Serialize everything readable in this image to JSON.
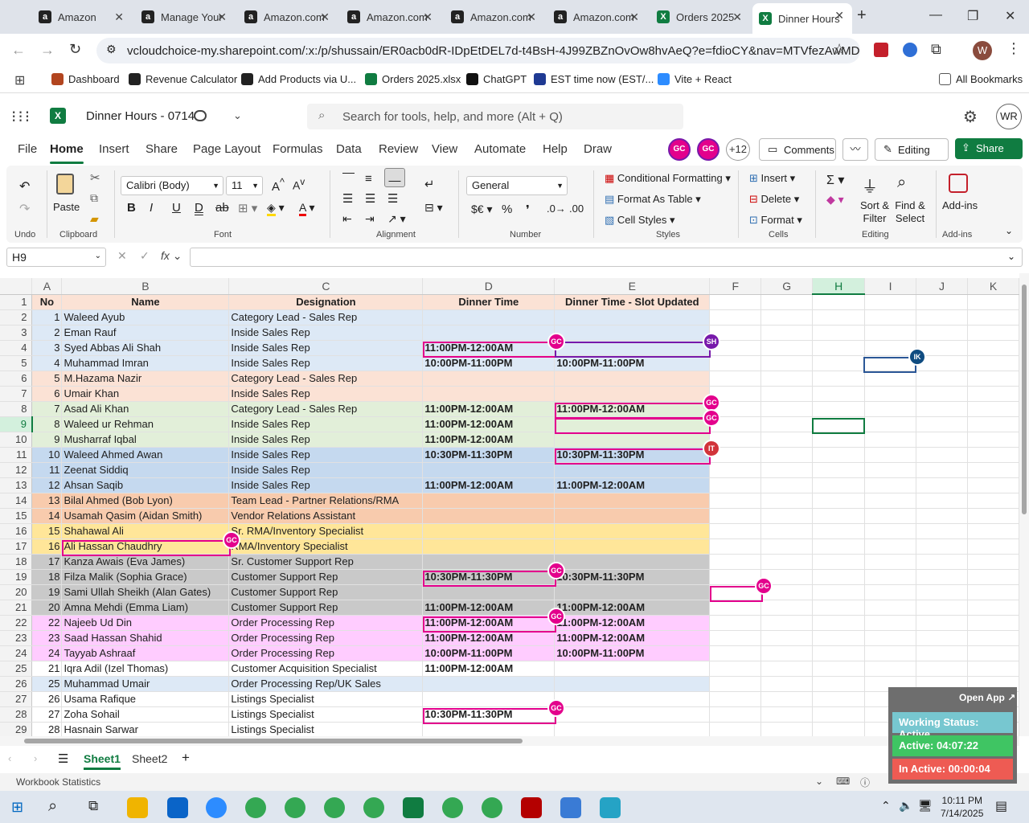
{
  "browser": {
    "tabs": [
      {
        "label": "Amazon",
        "icon": "amazon-icon"
      },
      {
        "label": "Manage Your",
        "icon": "amazon-icon"
      },
      {
        "label": "Amazon.com",
        "icon": "amazon-icon"
      },
      {
        "label": "Amazon.com",
        "icon": "amazon-icon"
      },
      {
        "label": "Amazon.com",
        "icon": "amazon-icon"
      },
      {
        "label": "Amazon.com",
        "icon": "amazon-icon"
      },
      {
        "label": "Orders 2025",
        "icon": "excel-icon"
      },
      {
        "label": "Dinner Hours",
        "icon": "excel-icon"
      }
    ],
    "url": "vcloudchoice-my.sharepoint.com/:x:/p/shussain/ER0acb0dR-IDpEtDEL7d-t4BsH-4J99ZBZnOvOw8hvAeQ?e=fdioCY&nav=MTVfezAwMDA...",
    "profile_initial": "W",
    "bookmarks": [
      "Dashboard",
      "Revenue Calculator",
      "Add Products via U...",
      "Orders 2025.xlsx",
      "ChatGPT",
      "EST time now (EST/...",
      "Vite + React"
    ],
    "all_bookmarks": "All Bookmarks"
  },
  "excel": {
    "doc_title": "Dinner Hours - 0714",
    "search_placeholder": "Search for tools, help, and more (Alt + Q)",
    "user_initials": "WR",
    "menus": [
      "File",
      "Home",
      "Insert",
      "Share",
      "Page Layout",
      "Formulas",
      "Data",
      "Review",
      "View",
      "Automate",
      "Help",
      "Draw"
    ],
    "collab_count": "+12",
    "comments_label": "Comments",
    "editing_label": "Editing",
    "share_label": "Share",
    "ribbon": {
      "undo_group": "Undo",
      "paste": "Paste",
      "clipboard": "Clipboard",
      "font_name": "Calibri (Body)",
      "font_size": "11",
      "font_group": "Font",
      "alignment_group": "Alignment",
      "number_format": "General",
      "number_group": "Number",
      "conditional_formatting": "Conditional Formatting",
      "format_as_table": "Format As Table",
      "cell_styles": "Cell Styles",
      "styles_group": "Styles",
      "insert": "Insert",
      "delete": "Delete",
      "format": "Format",
      "cells_group": "Cells",
      "sort_filter": "Sort & Filter",
      "find_select": "Find & Select",
      "editing_group": "Editing",
      "addins": "Add-ins",
      "addins_group": "Add-ins"
    },
    "name_box": "H9",
    "columns": [
      "A",
      "B",
      "C",
      "D",
      "E",
      "F",
      "G",
      "H",
      "I",
      "J",
      "K"
    ],
    "header_row": {
      "no": "No",
      "name": "Name",
      "designation": "Designation",
      "dinner": "Dinner Time",
      "slot": "Dinner Time - Slot Updated"
    },
    "rows": [
      {
        "r": "2",
        "no": "1",
        "name": "Waleed Ayub",
        "des": "Category Lead - Sales Rep",
        "d": "",
        "e": "",
        "bg": "#dde9f6"
      },
      {
        "r": "3",
        "no": "2",
        "name": "Eman Rauf",
        "des": "Inside Sales Rep",
        "d": "",
        "e": "",
        "bg": "#dde9f6"
      },
      {
        "r": "4",
        "no": "3",
        "name": "Syed Abbas Ali Shah",
        "des": "Inside Sales Rep",
        "d": "11:00PM-12:00AM",
        "e": "",
        "bg": "#dde9f6"
      },
      {
        "r": "5",
        "no": "4",
        "name": "Muhammad Imran",
        "des": "Inside Sales Rep",
        "d": "10:00PM-11:00PM",
        "e": "10:00PM-11:00PM",
        "bg": "#dde9f6"
      },
      {
        "r": "6",
        "no": "5",
        "name": "M.Hazama Nazir",
        "des": "Category Lead - Sales Rep",
        "d": "",
        "e": "",
        "bg": "#fbe2d5"
      },
      {
        "r": "7",
        "no": "6",
        "name": "Umair Khan",
        "des": "Inside Sales Rep",
        "d": "",
        "e": "",
        "bg": "#fbe2d5"
      },
      {
        "r": "8",
        "no": "7",
        "name": "Asad Ali Khan",
        "des": "Category Lead - Sales Rep",
        "d": "11:00PM-12:00AM",
        "e": "11:00PM-12:00AM",
        "bg": "#e2efd9"
      },
      {
        "r": "9",
        "no": "8",
        "name": "Waleed ur Rehman",
        "des": "Inside Sales Rep",
        "d": "11:00PM-12:00AM",
        "e": "",
        "bg": "#e2efd9"
      },
      {
        "r": "10",
        "no": "9",
        "name": "Musharraf Iqbal",
        "des": "Inside Sales Rep",
        "d": "11:00PM-12:00AM",
        "e": "",
        "bg": "#e2efd9"
      },
      {
        "r": "11",
        "no": "10",
        "name": "Waleed Ahmed Awan",
        "des": "Inside Sales Rep",
        "d": "10:30PM-11:30PM",
        "e": "10:30PM-11:30PM",
        "bg": "#c5d9ef"
      },
      {
        "r": "12",
        "no": "11",
        "name": "Zeenat Siddiq",
        "des": "Inside Sales Rep",
        "d": "",
        "e": "",
        "bg": "#c5d9ef"
      },
      {
        "r": "13",
        "no": "12",
        "name": "Ahsan Saqib",
        "des": "Inside Sales Rep",
        "d": "11:00PM-12:00AM",
        "e": "11:00PM-12:00AM",
        "bg": "#c5d9ef"
      },
      {
        "r": "14",
        "no": "13",
        "name": "Bilal Ahmed (Bob Lyon)",
        "des": "Team Lead - Partner Relations/RMA",
        "d": "",
        "e": "",
        "bg": "#f8cbad"
      },
      {
        "r": "15",
        "no": "14",
        "name": "Usamah Qasim (Aidan Smith)",
        "des": "Vendor Relations Assistant",
        "d": "",
        "e": "",
        "bg": "#f8cbad"
      },
      {
        "r": "16",
        "no": "15",
        "name": "Shahawal Ali",
        "des": "Sr. RMA/Inventory Specialist",
        "d": "",
        "e": "",
        "bg": "#ffe699"
      },
      {
        "r": "17",
        "no": "16",
        "name": "Ali Hassan Chaudhry",
        "des": "RMA/Inventory Specialist",
        "d": "",
        "e": "",
        "bg": "#ffe699"
      },
      {
        "r": "18",
        "no": "17",
        "name": "Kanza Awais (Eva James)",
        "des": "Sr. Customer Support Rep",
        "d": "",
        "e": "",
        "bg": "#c9c9c9"
      },
      {
        "r": "19",
        "no": "18",
        "name": "Filza Malik (Sophia Grace)",
        "des": "Customer Support Rep",
        "d": "10:30PM-11:30PM",
        "e": "10:30PM-11:30PM",
        "bg": "#c9c9c9"
      },
      {
        "r": "20",
        "no": "19",
        "name": "Sami Ullah Sheikh (Alan Gates)",
        "des": "Customer Support Rep",
        "d": "",
        "e": "",
        "bg": "#c9c9c9"
      },
      {
        "r": "21",
        "no": "20",
        "name": "Amna Mehdi (Emma Liam)",
        "des": "Customer Support Rep",
        "d": "11:00PM-12:00AM",
        "e": "11:00PM-12:00AM",
        "bg": "#c9c9c9"
      },
      {
        "r": "22",
        "no": "22",
        "name": "Najeeb Ud Din",
        "des": "Order Processing Rep",
        "d": "11:00PM-12:00AM",
        "e": "11:00PM-12:00AM",
        "bg": "#ffccff"
      },
      {
        "r": "23",
        "no": "23",
        "name": "Saad Hassan Shahid",
        "des": "Order Processing Rep",
        "d": "11:00PM-12:00AM",
        "e": "11:00PM-12:00AM",
        "bg": "#ffccff"
      },
      {
        "r": "24",
        "no": "24",
        "name": "Tayyab Ashraaf",
        "des": "Order Processing Rep",
        "d": "10:00PM-11:00PM",
        "e": "10:00PM-11:00PM",
        "bg": "#ffccff"
      },
      {
        "r": "25",
        "no": "21",
        "name": "Iqra Adil (Izel Thomas)",
        "des": "Customer Acquisition Specialist",
        "d": "11:00PM-12:00AM",
        "e": "",
        "bg": "#ffffff"
      },
      {
        "r": "26",
        "no": "25",
        "name": "Muhammad Umair",
        "des": "Order Processing Rep/UK Sales",
        "d": "",
        "e": "",
        "bg": "#dde9f6"
      },
      {
        "r": "27",
        "no": "26",
        "name": "Usama Rafique",
        "des": "Listings Specialist",
        "d": "",
        "e": "",
        "bg": "#ffffff"
      },
      {
        "r": "28",
        "no": "27",
        "name": "Zoha Sohail",
        "des": "Listings Specialist",
        "d": "10:30PM-11:30PM",
        "e": "",
        "bg": "#ffffff"
      },
      {
        "r": "29",
        "no": "28",
        "name": "Hasnain Sarwar",
        "des": "Listings Specialist",
        "d": "",
        "e": "",
        "bg": "#ffffff"
      }
    ],
    "sheets": [
      "Sheet1",
      "Sheet2"
    ],
    "status_left": "Workbook Statistics",
    "open_app": "Open App",
    "working_status": "Working Status: Active",
    "active_time": "Active: 04:07:22",
    "inactive_time": "In Active: 00:00:04"
  },
  "presence": [
    "GC",
    "SH",
    "IK",
    "IT"
  ],
  "taskbar": {
    "time": "10:11 PM",
    "date": "7/14/2025"
  }
}
